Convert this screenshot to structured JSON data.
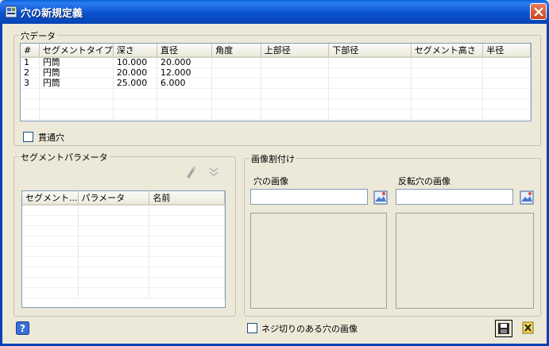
{
  "window": {
    "title": "穴の新規定義"
  },
  "hole_data": {
    "legend": "穴データ",
    "columns": [
      "#",
      "セグメントタイプ",
      "深さ",
      "直径",
      "角度",
      "上部径",
      "下部径",
      "セグメント高さ",
      "半径"
    ],
    "rows": [
      [
        "1",
        "円筒",
        "10.000",
        "20.000",
        "",
        "",
        "",
        "",
        ""
      ],
      [
        "2",
        "円筒",
        "20.000",
        "12.000",
        "",
        "",
        "",
        "",
        ""
      ],
      [
        "3",
        "円筒",
        "25.000",
        "6.000",
        "",
        "",
        "",
        "",
        ""
      ]
    ],
    "through_hole_label": "貫通穴"
  },
  "segment_params": {
    "legend": "セグメントパラメータ",
    "columns": [
      "セグメント...",
      "パラメータ",
      "名前"
    ]
  },
  "image_assign": {
    "legend": "画像割付け",
    "hole_image_label": "穴の画像",
    "hole_image_value": "",
    "reverse_image_label": "反転穴の画像",
    "reverse_image_value": ""
  },
  "footer": {
    "threaded_label": "ネジ切りのある穴の画像"
  }
}
